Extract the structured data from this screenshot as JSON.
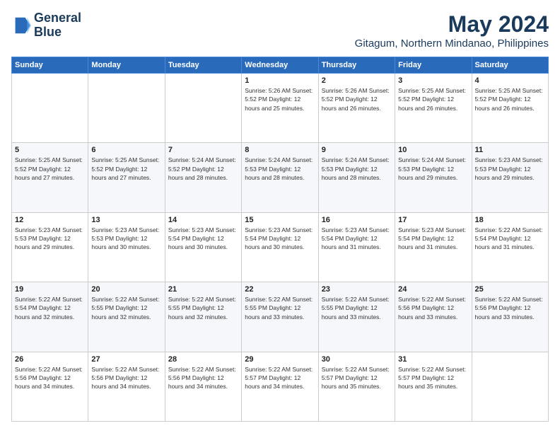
{
  "logo": {
    "line1": "General",
    "line2": "Blue"
  },
  "title": "May 2024",
  "subtitle": "Gitagum, Northern Mindanao, Philippines",
  "weekdays": [
    "Sunday",
    "Monday",
    "Tuesday",
    "Wednesday",
    "Thursday",
    "Friday",
    "Saturday"
  ],
  "weeks": [
    [
      {
        "day": "",
        "info": ""
      },
      {
        "day": "",
        "info": ""
      },
      {
        "day": "",
        "info": ""
      },
      {
        "day": "1",
        "info": "Sunrise: 5:26 AM\nSunset: 5:52 PM\nDaylight: 12 hours\nand 25 minutes."
      },
      {
        "day": "2",
        "info": "Sunrise: 5:26 AM\nSunset: 5:52 PM\nDaylight: 12 hours\nand 26 minutes."
      },
      {
        "day": "3",
        "info": "Sunrise: 5:25 AM\nSunset: 5:52 PM\nDaylight: 12 hours\nand 26 minutes."
      },
      {
        "day": "4",
        "info": "Sunrise: 5:25 AM\nSunset: 5:52 PM\nDaylight: 12 hours\nand 26 minutes."
      }
    ],
    [
      {
        "day": "5",
        "info": "Sunrise: 5:25 AM\nSunset: 5:52 PM\nDaylight: 12 hours\nand 27 minutes."
      },
      {
        "day": "6",
        "info": "Sunrise: 5:25 AM\nSunset: 5:52 PM\nDaylight: 12 hours\nand 27 minutes."
      },
      {
        "day": "7",
        "info": "Sunrise: 5:24 AM\nSunset: 5:52 PM\nDaylight: 12 hours\nand 28 minutes."
      },
      {
        "day": "8",
        "info": "Sunrise: 5:24 AM\nSunset: 5:53 PM\nDaylight: 12 hours\nand 28 minutes."
      },
      {
        "day": "9",
        "info": "Sunrise: 5:24 AM\nSunset: 5:53 PM\nDaylight: 12 hours\nand 28 minutes."
      },
      {
        "day": "10",
        "info": "Sunrise: 5:24 AM\nSunset: 5:53 PM\nDaylight: 12 hours\nand 29 minutes."
      },
      {
        "day": "11",
        "info": "Sunrise: 5:23 AM\nSunset: 5:53 PM\nDaylight: 12 hours\nand 29 minutes."
      }
    ],
    [
      {
        "day": "12",
        "info": "Sunrise: 5:23 AM\nSunset: 5:53 PM\nDaylight: 12 hours\nand 29 minutes."
      },
      {
        "day": "13",
        "info": "Sunrise: 5:23 AM\nSunset: 5:53 PM\nDaylight: 12 hours\nand 30 minutes."
      },
      {
        "day": "14",
        "info": "Sunrise: 5:23 AM\nSunset: 5:54 PM\nDaylight: 12 hours\nand 30 minutes."
      },
      {
        "day": "15",
        "info": "Sunrise: 5:23 AM\nSunset: 5:54 PM\nDaylight: 12 hours\nand 30 minutes."
      },
      {
        "day": "16",
        "info": "Sunrise: 5:23 AM\nSunset: 5:54 PM\nDaylight: 12 hours\nand 31 minutes."
      },
      {
        "day": "17",
        "info": "Sunrise: 5:23 AM\nSunset: 5:54 PM\nDaylight: 12 hours\nand 31 minutes."
      },
      {
        "day": "18",
        "info": "Sunrise: 5:22 AM\nSunset: 5:54 PM\nDaylight: 12 hours\nand 31 minutes."
      }
    ],
    [
      {
        "day": "19",
        "info": "Sunrise: 5:22 AM\nSunset: 5:54 PM\nDaylight: 12 hours\nand 32 minutes."
      },
      {
        "day": "20",
        "info": "Sunrise: 5:22 AM\nSunset: 5:55 PM\nDaylight: 12 hours\nand 32 minutes."
      },
      {
        "day": "21",
        "info": "Sunrise: 5:22 AM\nSunset: 5:55 PM\nDaylight: 12 hours\nand 32 minutes."
      },
      {
        "day": "22",
        "info": "Sunrise: 5:22 AM\nSunset: 5:55 PM\nDaylight: 12 hours\nand 33 minutes."
      },
      {
        "day": "23",
        "info": "Sunrise: 5:22 AM\nSunset: 5:55 PM\nDaylight: 12 hours\nand 33 minutes."
      },
      {
        "day": "24",
        "info": "Sunrise: 5:22 AM\nSunset: 5:56 PM\nDaylight: 12 hours\nand 33 minutes."
      },
      {
        "day": "25",
        "info": "Sunrise: 5:22 AM\nSunset: 5:56 PM\nDaylight: 12 hours\nand 33 minutes."
      }
    ],
    [
      {
        "day": "26",
        "info": "Sunrise: 5:22 AM\nSunset: 5:56 PM\nDaylight: 12 hours\nand 34 minutes."
      },
      {
        "day": "27",
        "info": "Sunrise: 5:22 AM\nSunset: 5:56 PM\nDaylight: 12 hours\nand 34 minutes."
      },
      {
        "day": "28",
        "info": "Sunrise: 5:22 AM\nSunset: 5:56 PM\nDaylight: 12 hours\nand 34 minutes."
      },
      {
        "day": "29",
        "info": "Sunrise: 5:22 AM\nSunset: 5:57 PM\nDaylight: 12 hours\nand 34 minutes."
      },
      {
        "day": "30",
        "info": "Sunrise: 5:22 AM\nSunset: 5:57 PM\nDaylight: 12 hours\nand 35 minutes."
      },
      {
        "day": "31",
        "info": "Sunrise: 5:22 AM\nSunset: 5:57 PM\nDaylight: 12 hours\nand 35 minutes."
      },
      {
        "day": "",
        "info": ""
      }
    ]
  ]
}
